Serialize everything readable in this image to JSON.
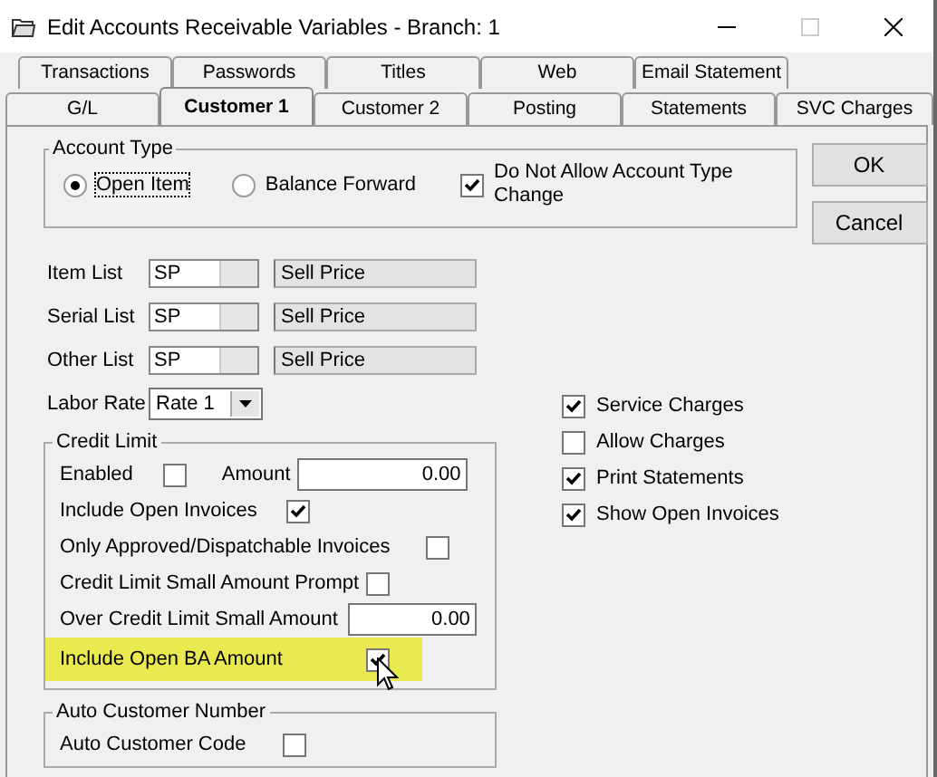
{
  "window": {
    "title": "Edit Accounts Receivable Variables  - Branch: 1"
  },
  "tab_rows": [
    {
      "tabs": [
        {
          "label": "Transactions",
          "selected": false
        },
        {
          "label": "Passwords",
          "selected": false
        },
        {
          "label": "Titles",
          "selected": false
        },
        {
          "label": "Web",
          "selected": false
        },
        {
          "label": "Email Statement",
          "selected": false
        }
      ]
    },
    {
      "tabs": [
        {
          "label": "G/L",
          "selected": false
        },
        {
          "label": "Customer 1",
          "selected": true
        },
        {
          "label": "Customer 2",
          "selected": false
        },
        {
          "label": "Posting",
          "selected": false
        },
        {
          "label": "Statements",
          "selected": false
        },
        {
          "label": "SVC Charges",
          "selected": false
        }
      ]
    }
  ],
  "account_type": {
    "title": "Account Type",
    "options": [
      {
        "label": "Open Item",
        "selected": true
      },
      {
        "label": "Balance Forward",
        "selected": false
      }
    ],
    "lock": {
      "label": "Do Not Allow Account Type Change",
      "checked": true
    }
  },
  "buttons": [
    "OK",
    "Cancel"
  ],
  "lists": [
    {
      "label": "Item List",
      "code": "SP",
      "description": "Sell Price"
    },
    {
      "label": "Serial List",
      "code": "SP",
      "description": "Sell Price"
    },
    {
      "label": "Other List",
      "code": "SP",
      "description": "Sell Price"
    }
  ],
  "labor_rate": {
    "label": "Labor Rate",
    "value": "Rate 1"
  },
  "credit_limit": {
    "title": "Credit Limit",
    "enabled": {
      "label": "Enabled",
      "checked": false
    },
    "amount": {
      "label": "Amount",
      "value": "0.00"
    },
    "items": [
      {
        "kind": "checkbox",
        "label": "Include Open Invoices",
        "checked": true,
        "highlighted": false
      },
      {
        "kind": "checkbox",
        "label": "Only Approved/Dispatchable Invoices",
        "checked": false,
        "highlighted": false
      },
      {
        "kind": "checkbox",
        "label": "Credit Limit Small Amount Prompt",
        "checked": false,
        "highlighted": false
      },
      {
        "kind": "amount",
        "label": "Over Credit Limit Small Amount",
        "value": "0.00",
        "highlighted": false
      },
      {
        "kind": "checkbox",
        "label": "Include Open BA Amount",
        "checked": true,
        "highlighted": true
      }
    ]
  },
  "options": [
    {
      "label": "Service Charges",
      "checked": true
    },
    {
      "label": "Allow Charges",
      "checked": false
    },
    {
      "label": "Print Statements",
      "checked": true
    },
    {
      "label": "Show Open Invoices",
      "checked": true
    }
  ],
  "auto_customer_number": {
    "title": "Auto Customer Number",
    "items": [
      {
        "label": "Auto Customer Code",
        "checked": false
      }
    ]
  }
}
